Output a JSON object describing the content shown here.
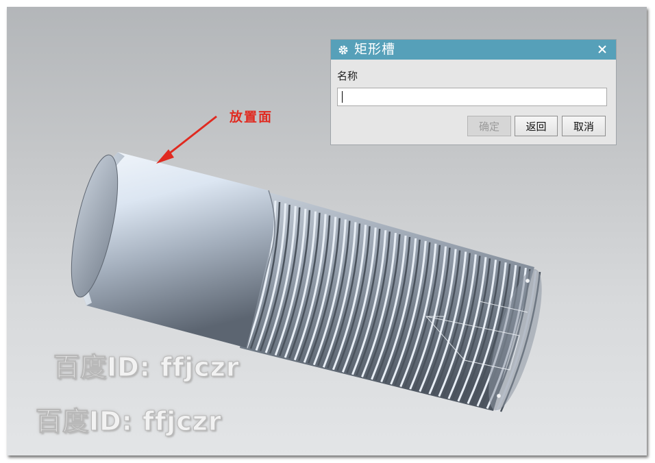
{
  "dialog": {
    "title": "矩形槽",
    "title_icon": "gear-icon",
    "close_icon": "close-icon",
    "name_label": "名称",
    "name_value": "",
    "buttons": {
      "ok": "确定",
      "back": "返回",
      "cancel": "取消"
    },
    "title_bar_color": "#56a0b9"
  },
  "annotation": {
    "label": "放置面",
    "color": "#e02a20"
  },
  "watermarks": [
    "百度ID: ffjczr",
    "百度ID: ffjczr"
  ]
}
